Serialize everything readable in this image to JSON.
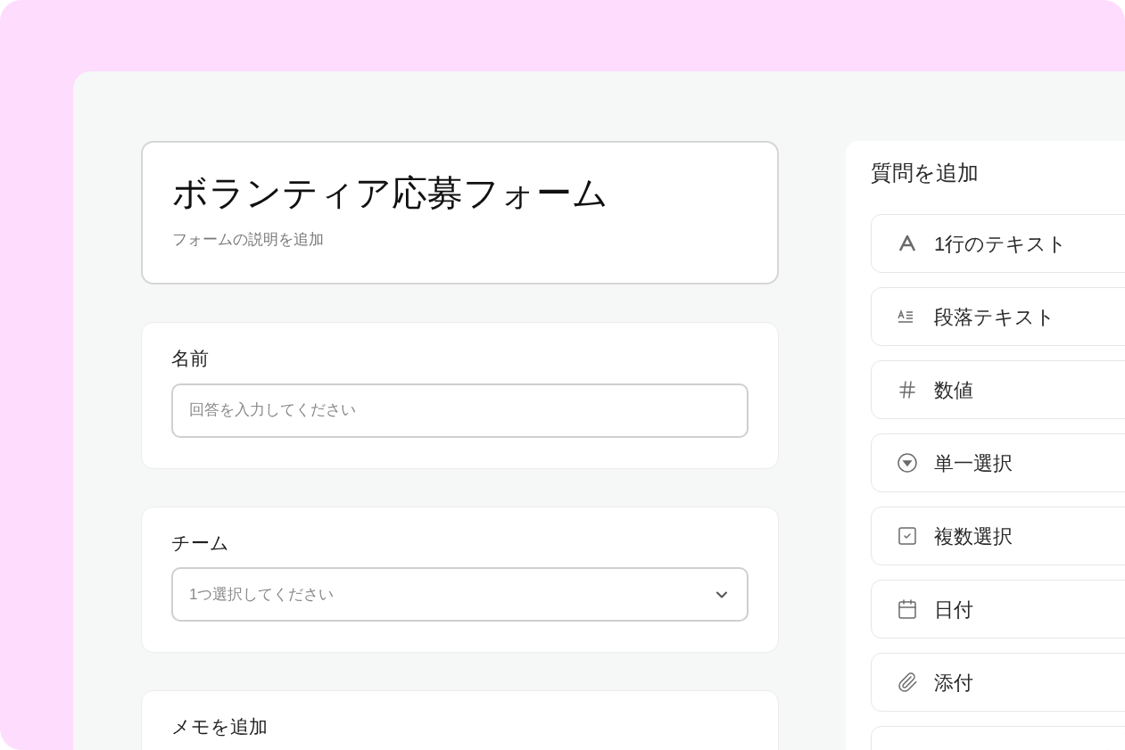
{
  "form": {
    "title": "ボランティア応募フォーム",
    "description": "フォームの説明を追加"
  },
  "questions": [
    {
      "kind": "text",
      "label": "名前",
      "placeholder": "回答を入力してください"
    },
    {
      "kind": "select",
      "label": "チーム",
      "placeholder": "1つ選択してください"
    },
    {
      "kind": "note",
      "label": "メモを追加"
    }
  ],
  "sidebar": {
    "title": "質問を追加",
    "items": [
      {
        "kind": "short",
        "label": "1行のテキスト"
      },
      {
        "kind": "paragraph",
        "label": "段落テキスト"
      },
      {
        "kind": "number",
        "label": "数値"
      },
      {
        "kind": "single",
        "label": "単一選択"
      },
      {
        "kind": "multiple",
        "label": "複数選択"
      },
      {
        "kind": "date",
        "label": "日付"
      },
      {
        "kind": "attachment",
        "label": "添付"
      }
    ]
  }
}
